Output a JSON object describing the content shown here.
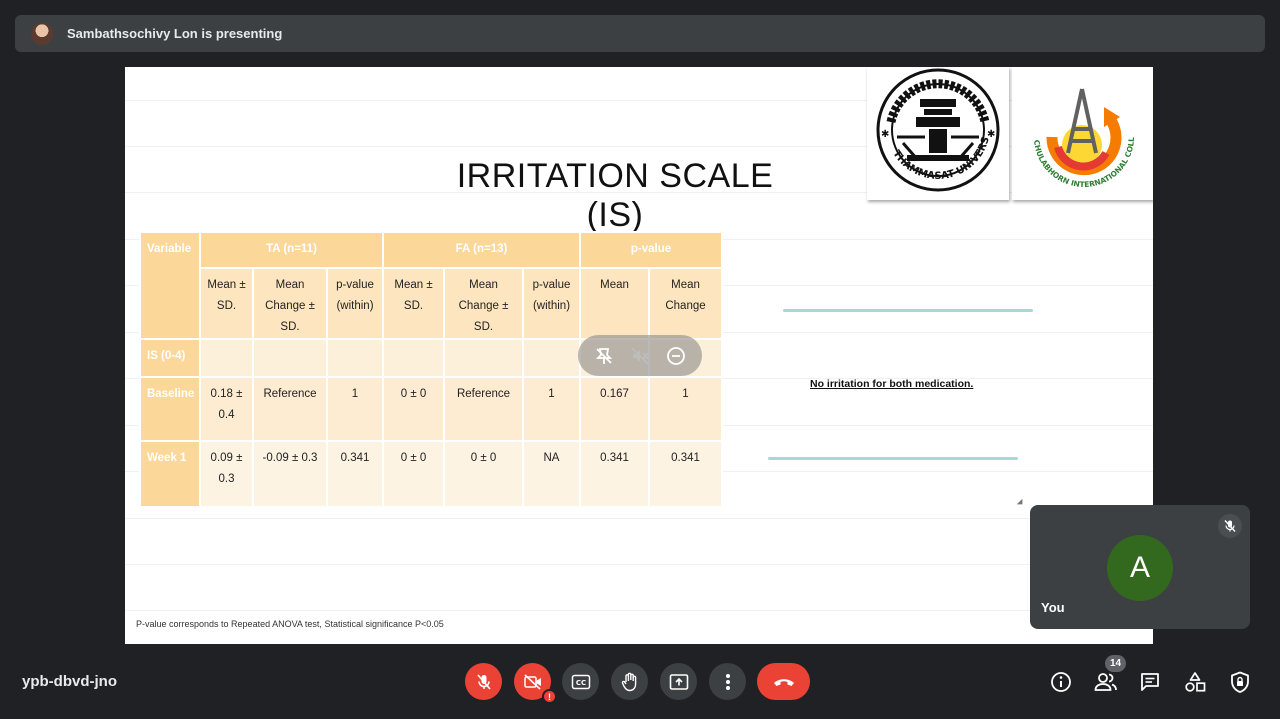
{
  "presenter": {
    "text": "Sambathsochivy Lon is presenting"
  },
  "slide": {
    "title": "IRRITATION SCALE (IS)",
    "logos": {
      "left": "THAMMASAT UNIVERSITY",
      "right": "CHULABHORN INTERNATIONAL COLLEGE OF MEDICINE"
    },
    "table": {
      "variable_header": "Variable",
      "group_headers": [
        "TA (n=11)",
        "FA (n=13)",
        "p-value"
      ],
      "sub_headers": [
        "Mean ±\nSD.",
        "Mean\nChange ±\nSD.",
        "p-value\n(within)",
        "Mean ±\nSD.",
        "Mean\nChange ±\nSD.",
        "p-value\n(within)",
        "Mean",
        "Mean\nChange"
      ],
      "rows": [
        {
          "label": "IS (0-4)",
          "cells": [
            "",
            "",
            "",
            "",
            "",
            "",
            "",
            ""
          ]
        },
        {
          "label": "Baseline",
          "cells": [
            "0.18 ±\n0.4",
            "Reference",
            "1",
            "0 ± 0",
            "Reference",
            "1",
            "0.167",
            "1"
          ]
        },
        {
          "label": "Week 1",
          "cells": [
            "0.09 ±\n0.3",
            "-0.09 ± 0.3",
            "0.341",
            "0 ± 0",
            "0 ± 0",
            "NA",
            "0.341",
            "0.341"
          ]
        }
      ]
    },
    "note": "No irritation for both medication.",
    "footnote": "P-value corresponds to Repeated ANOVA test, Statistical significance P<0.05"
  },
  "self_tile": {
    "avatar_letter": "A",
    "label": "You"
  },
  "meeting_code": "ypb-dbvd-jno",
  "people_count": "14",
  "colors": {
    "accent_red": "#ea4335",
    "avatar_green": "#33691e",
    "table_header": "#fbd89a"
  }
}
